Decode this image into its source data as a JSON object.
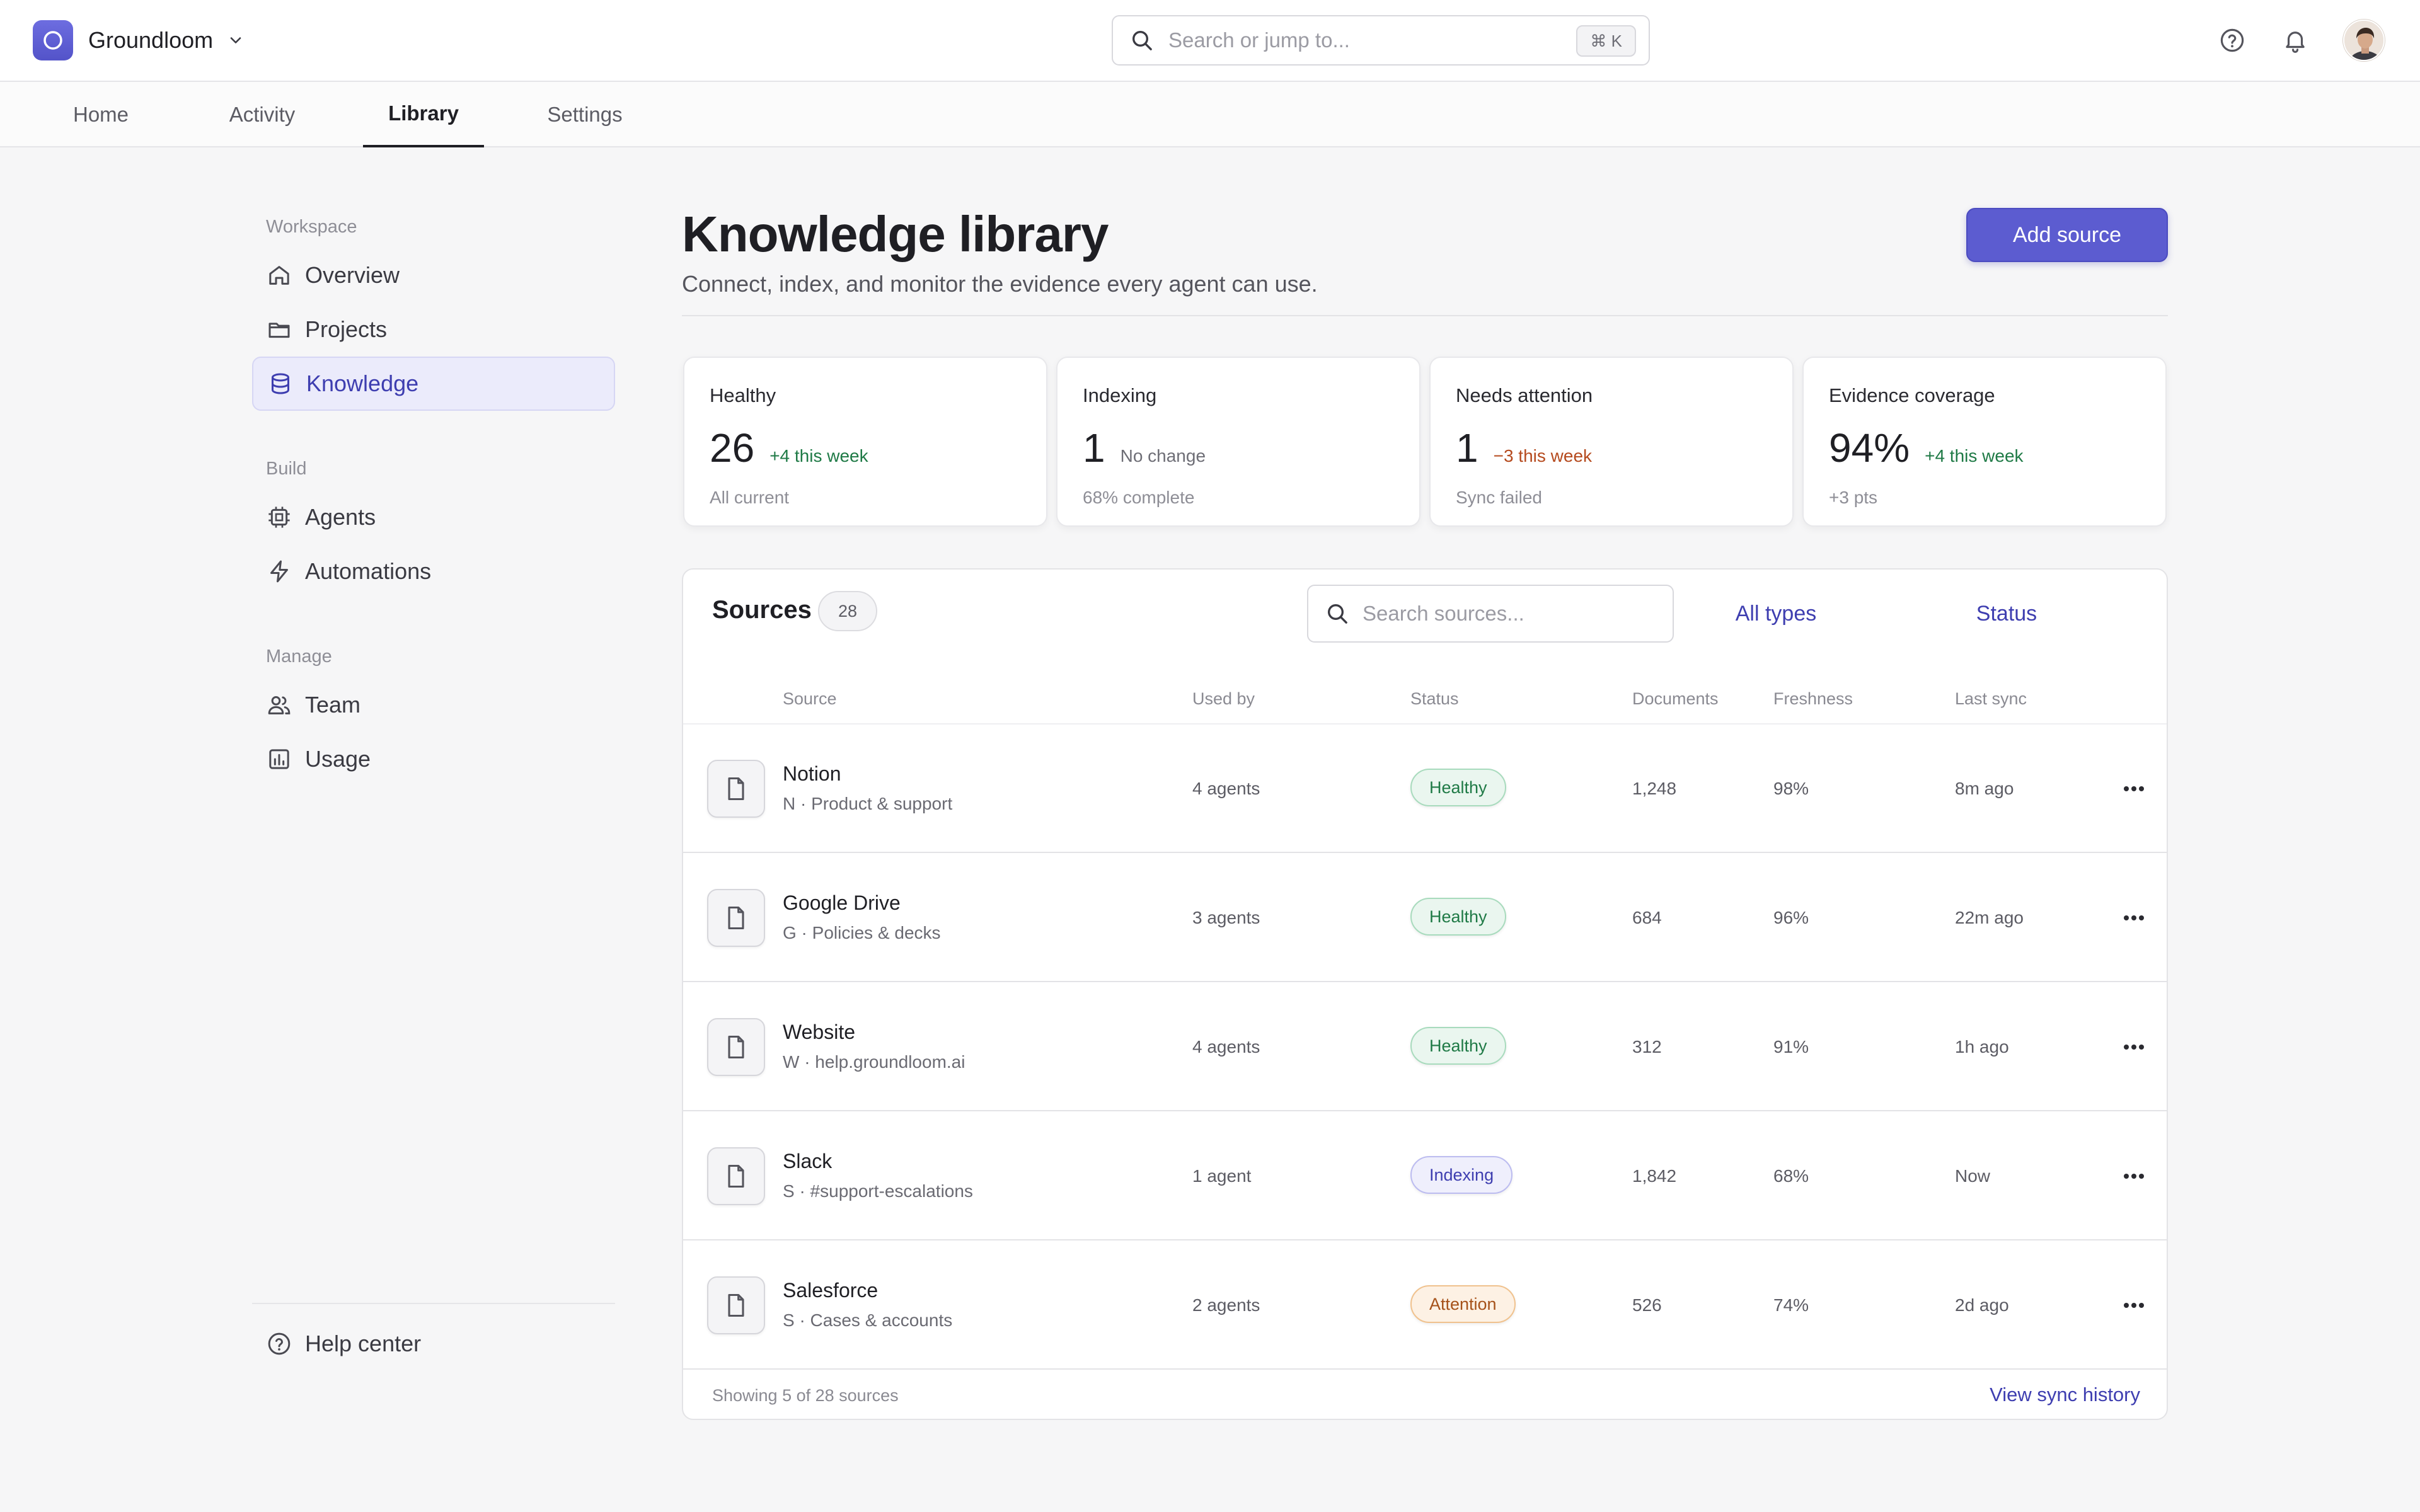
{
  "app": {
    "name": "Groundloom",
    "search_placeholder": "Search or jump to...",
    "search_shortcut": "⌘ K"
  },
  "tabs": [
    {
      "label": "Home"
    },
    {
      "label": "Activity"
    },
    {
      "label": "Library",
      "active": true
    },
    {
      "label": "Settings"
    }
  ],
  "sidebar": {
    "sections": [
      {
        "title": "Workspace",
        "items": [
          {
            "label": "Overview",
            "icon": "home-icon"
          },
          {
            "label": "Projects",
            "icon": "folder-icon"
          },
          {
            "label": "Knowledge",
            "icon": "database-icon",
            "active": true
          }
        ]
      },
      {
        "title": "Build",
        "items": [
          {
            "label": "Agents",
            "icon": "cpu-icon"
          },
          {
            "label": "Automations",
            "icon": "bolt-icon"
          }
        ]
      },
      {
        "title": "Manage",
        "items": [
          {
            "label": "Team",
            "icon": "users-icon"
          },
          {
            "label": "Usage",
            "icon": "bar-chart-icon"
          }
        ]
      }
    ],
    "help": {
      "label": "Help center",
      "icon": "help-circle-icon"
    }
  },
  "page": {
    "title": "Knowledge library",
    "subtitle": "Connect, index, and monitor the evidence every agent can use.",
    "primary_action": "Add source"
  },
  "stats": [
    {
      "label": "Healthy",
      "value": "26",
      "delta": "+4 this week",
      "trend": "up",
      "note": "All current"
    },
    {
      "label": "Indexing",
      "value": "1",
      "delta": "No change",
      "trend": "neutral",
      "note": "68% complete"
    },
    {
      "label": "Needs attention",
      "value": "1",
      "delta": "−3 this week",
      "trend": "down",
      "note": "Sync failed"
    },
    {
      "label": "Evidence coverage",
      "value": "94%",
      "delta": "+4 this week",
      "trend": "up",
      "note": "+3 pts"
    }
  ],
  "sources": {
    "title": "Sources",
    "count": "28",
    "search_placeholder": "Search sources...",
    "filters": {
      "type": "All types",
      "status": "Status"
    },
    "columns": {
      "source": "Source",
      "used_by": "Used by",
      "status": "Status",
      "documents": "Documents",
      "freshness": "Freshness",
      "last_sync": "Last sync"
    },
    "rows": [
      {
        "name": "Notion",
        "meta": "N · Product & support",
        "used_by": "4 agents",
        "status": "Healthy",
        "status_kind": "healthy",
        "documents": "1,248",
        "freshness": "98%",
        "last_sync": "8m ago"
      },
      {
        "name": "Google Drive",
        "meta": "G · Policies & decks",
        "used_by": "3 agents",
        "status": "Healthy",
        "status_kind": "healthy",
        "documents": "684",
        "freshness": "96%",
        "last_sync": "22m ago"
      },
      {
        "name": "Website",
        "meta": "W · help.groundloom.ai",
        "used_by": "4 agents",
        "status": "Healthy",
        "status_kind": "healthy",
        "documents": "312",
        "freshness": "91%",
        "last_sync": "1h ago"
      },
      {
        "name": "Slack",
        "meta": "S · #support-escalations",
        "used_by": "1 agent",
        "status": "Indexing",
        "status_kind": "indexing",
        "documents": "1,842",
        "freshness": "68%",
        "last_sync": "Now"
      },
      {
        "name": "Salesforce",
        "meta": "S · Cases & accounts",
        "used_by": "2 agents",
        "status": "Attention",
        "status_kind": "attention",
        "documents": "526",
        "freshness": "74%",
        "last_sync": "2d ago"
      }
    ],
    "footer_text": "Showing 5 of 28 sources",
    "footer_link": "View sync history"
  },
  "colors": {
    "accent": "#5c5cd0",
    "healthy": "#1f7a46",
    "indexing": "#3e3eb0",
    "attention": "#a6521a"
  }
}
